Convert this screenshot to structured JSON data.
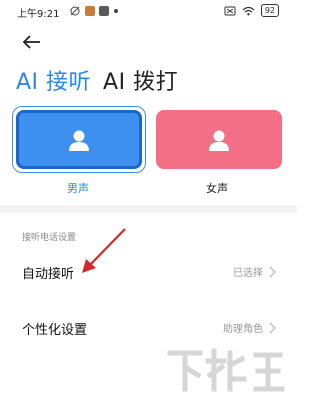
{
  "status_bar": {
    "time": "上午9:21",
    "battery": "92",
    "icons": [
      "no-alarm-icon",
      "app-icon",
      "app-icon",
      "notification-dot-icon",
      "sim-off-icon",
      "wifi-icon",
      "battery-icon"
    ]
  },
  "header": {
    "back_icon": "arrow-left-icon"
  },
  "tabs": [
    {
      "label": "AI 接听",
      "active": true
    },
    {
      "label": "AI 拨打",
      "active": false
    }
  ],
  "voices": [
    {
      "label": "男声",
      "selected": true,
      "color": "#3d8ff0"
    },
    {
      "label": "女声",
      "selected": false,
      "color": "#f36f86"
    }
  ],
  "settings": {
    "section_title": "接听电话设置",
    "items": [
      {
        "label": "自动接听",
        "value": "已选择"
      },
      {
        "label": "个性化设置",
        "value": "助理角色"
      }
    ]
  },
  "colors": {
    "accent": "#2f86e6",
    "annotation_arrow": "#d8252c"
  }
}
